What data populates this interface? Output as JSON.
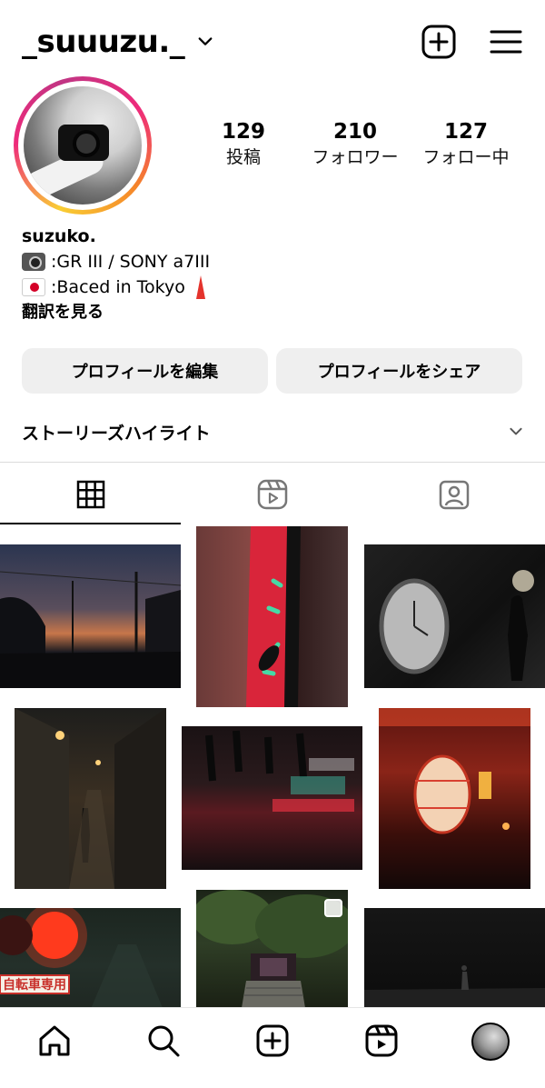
{
  "header": {
    "username": "_suuuzu._",
    "icons": [
      "chevron-down-icon",
      "add-post-icon",
      "menu-icon"
    ]
  },
  "stats": {
    "posts_count": "129",
    "posts_label": "投稿",
    "followers_count": "210",
    "followers_label": "フォロワー",
    "following_count": "127",
    "following_label": "フォロー中"
  },
  "bio": {
    "name": "suzuko.",
    "line1": ":GR III / SONY a7III",
    "line2": ":Baced in Tokyo",
    "translate": "翻訳を見る",
    "emojis": [
      "camera-emoji",
      "japan-flag-emoji",
      "tokyo-tower-emoji"
    ]
  },
  "buttons": {
    "edit_profile": "プロフィールを編集",
    "share_profile": "プロフィールをシェア"
  },
  "highlights": {
    "label": "ストーリーズハイライト"
  },
  "tabs": [
    {
      "icon": "grid-icon",
      "active": true
    },
    {
      "icon": "reels-icon",
      "active": false
    },
    {
      "icon": "tagged-icon",
      "active": false
    }
  ],
  "grid": {
    "photos": [
      {
        "name": "dusk-street-photo"
      },
      {
        "name": "red-neon-sign-photo"
      },
      {
        "name": "clock-silhouette-photo"
      },
      {
        "name": "night-alley-photo"
      },
      {
        "name": "wet-street-reflection-photo"
      },
      {
        "name": "red-lantern-photo"
      },
      {
        "name": "traffic-light-photo",
        "text": "自転車専用"
      },
      {
        "name": "shrine-trees-photo",
        "badge": "multi-post-icon"
      },
      {
        "name": "dark-street-photo"
      }
    ]
  },
  "bottom_nav": {
    "items": [
      "home-icon",
      "search-icon",
      "create-icon",
      "reels-icon",
      "profile-avatar"
    ]
  },
  "colors": {
    "button_bg": "#efefef",
    "divider": "#dbdbdb",
    "ring_gradient": [
      "#f9ce34",
      "#ee2a7b",
      "#c13584"
    ]
  }
}
